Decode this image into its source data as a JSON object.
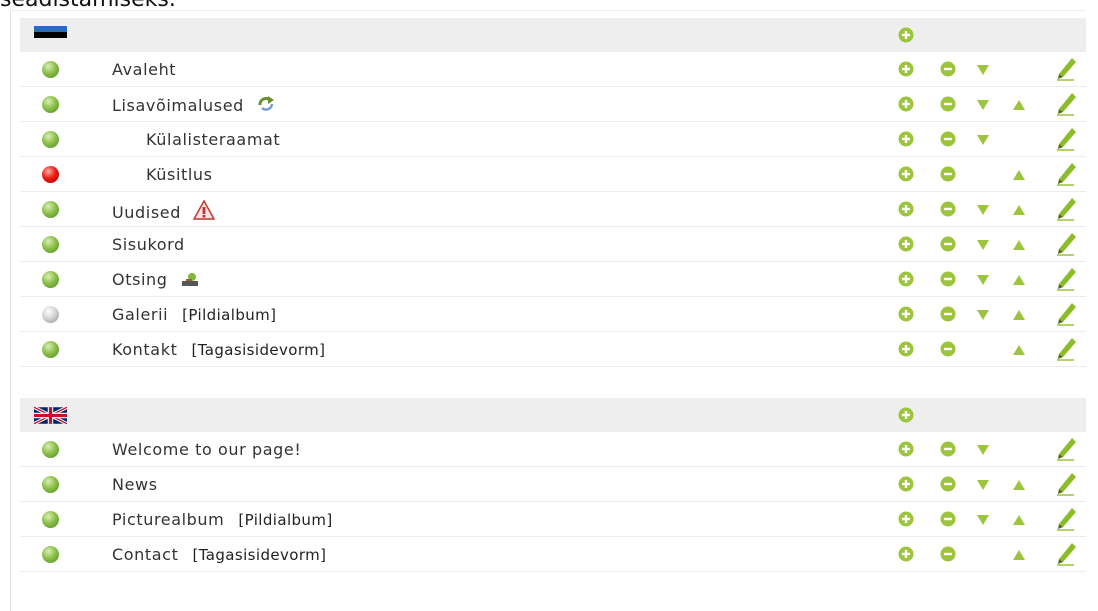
{
  "top_text": "seadistamiseks.",
  "colors": {
    "action": "#9cc43c",
    "header_bg": "#eeeeee"
  },
  "icons": {
    "add": "plus-circle-icon",
    "remove": "minus-circle-icon",
    "down": "triangle-down-icon",
    "up": "triangle-up-icon",
    "edit": "pencil-icon"
  },
  "groups": [
    {
      "flag": "estonian-flag",
      "items": [
        {
          "label": "Avaleht",
          "status": "green",
          "indent": false,
          "actions": [
            "add",
            "remove",
            "down",
            "edit"
          ]
        },
        {
          "label": "Lisavõimalused",
          "status": "green",
          "indent": false,
          "badge": "refresh-icon",
          "actions": [
            "add",
            "remove",
            "down",
            "up",
            "edit"
          ]
        },
        {
          "label": "Külalisteraamat",
          "status": "green",
          "indent": true,
          "actions": [
            "add",
            "remove",
            "down",
            "edit"
          ]
        },
        {
          "label": "Küsitlus",
          "status": "red",
          "indent": true,
          "actions": [
            "add",
            "remove",
            "up",
            "edit"
          ]
        },
        {
          "label": "Uudised",
          "status": "green",
          "indent": false,
          "badge": "warning-icon",
          "actions": [
            "add",
            "remove",
            "down",
            "up",
            "edit"
          ]
        },
        {
          "label": "Sisukord",
          "status": "green",
          "indent": false,
          "actions": [
            "add",
            "remove",
            "down",
            "up",
            "edit"
          ]
        },
        {
          "label": "Otsing",
          "status": "green",
          "indent": false,
          "badge": "search-module-icon",
          "actions": [
            "add",
            "remove",
            "down",
            "up",
            "edit"
          ]
        },
        {
          "label": "Galerii",
          "extra": "[Pildialbum]",
          "status": "grey",
          "indent": false,
          "actions": [
            "add",
            "remove",
            "down",
            "up",
            "edit"
          ]
        },
        {
          "label": "Kontakt",
          "extra": "[Tagasisidevorm]",
          "status": "green",
          "indent": false,
          "actions": [
            "add",
            "remove",
            "up",
            "edit"
          ]
        }
      ]
    },
    {
      "flag": "uk-flag",
      "items": [
        {
          "label": "Welcome to our page!",
          "status": "green",
          "indent": false,
          "actions": [
            "add",
            "remove",
            "down",
            "edit"
          ]
        },
        {
          "label": "News",
          "status": "green",
          "indent": false,
          "actions": [
            "add",
            "remove",
            "down",
            "up",
            "edit"
          ]
        },
        {
          "label": "Picturealbum",
          "extra": "[Pildialbum]",
          "status": "green",
          "indent": false,
          "actions": [
            "add",
            "remove",
            "down",
            "up",
            "edit"
          ]
        },
        {
          "label": "Contact",
          "extra": "[Tagasisidevorm]",
          "status": "green",
          "indent": false,
          "actions": [
            "add",
            "remove",
            "up",
            "edit"
          ]
        }
      ]
    }
  ]
}
